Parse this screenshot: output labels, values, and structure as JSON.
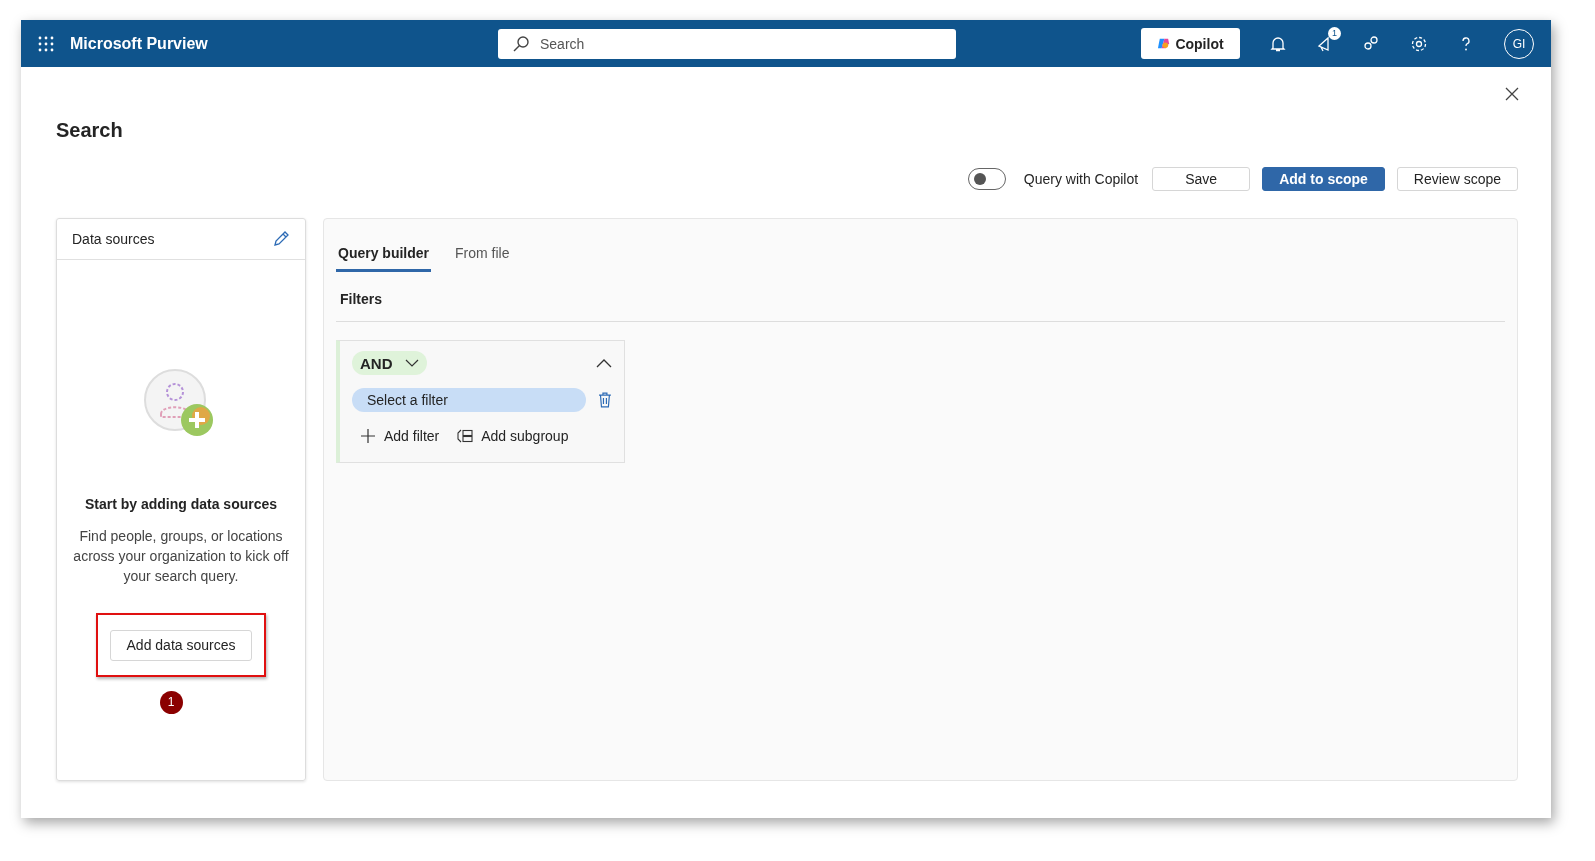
{
  "top_bar": {
    "app_name": "Microsoft Purview",
    "search": {
      "placeholder": "Search"
    },
    "copilot_label": "Copilot",
    "notification_count": "1",
    "avatar_initials": "GI"
  },
  "page": {
    "title": "Search"
  },
  "toolbar": {
    "copilot_toggle": {
      "label": "Query with Copilot",
      "on": false
    },
    "buttons": [
      {
        "label": "Save",
        "kind": "default"
      },
      {
        "label": "Add to scope",
        "kind": "primary"
      },
      {
        "label": "Review scope",
        "kind": "default"
      }
    ]
  },
  "data_sources": {
    "title": "Data sources",
    "empty_title": "Start by adding data sources",
    "empty_description": "Find people, groups, or locations across your organization to kick off your search query.",
    "add_button": "Add data sources",
    "step_marker": "1"
  },
  "tabs": [
    {
      "label": "Query builder",
      "selected": true
    },
    {
      "label": "From file",
      "selected": false
    }
  ],
  "filters": {
    "label": "Filters",
    "group": {
      "operator": "AND",
      "expanded": true,
      "filter_placeholder": "Select a filter",
      "actions": [
        {
          "label": "Add filter",
          "kind": "add"
        },
        {
          "label": "Add subgroup",
          "kind": "subgroup"
        }
      ]
    }
  }
}
